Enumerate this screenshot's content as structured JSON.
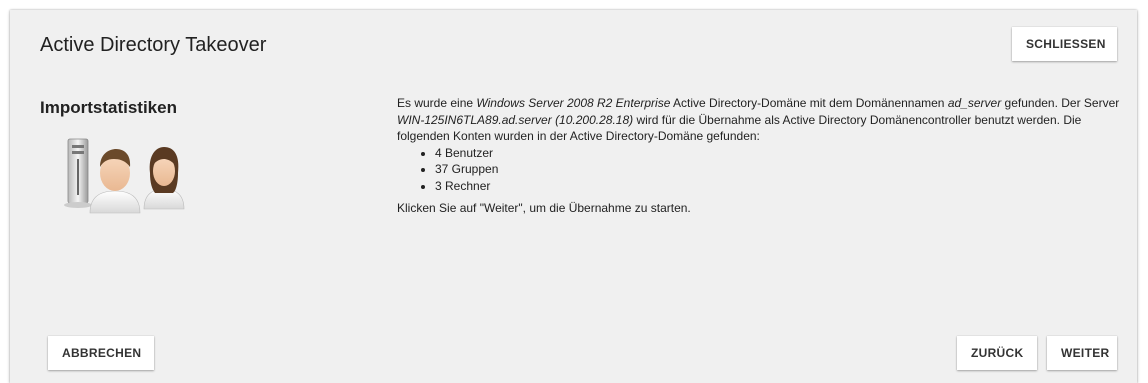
{
  "dialog": {
    "title": "Active Directory Takeover",
    "close_label": "SCHLIESSEN",
    "cancel_label": "ABBRECHEN",
    "back_label": "ZURÜCK",
    "next_label": "WEITER"
  },
  "sidebar": {
    "title": "Importstatistiken",
    "illustration_icon": "server-users-icon"
  },
  "content": {
    "intro_1": "Es wurde eine ",
    "os_name": "Windows Server 2008 R2 Enterprise",
    "intro_2": " Active Directory-Domäne mit dem Domänennamen ",
    "domain_name": "ad_server",
    "intro_3": " gefunden. Der Server ",
    "server_name": "WIN-125IN6TLA89.ad.server (10.200.28.18)",
    "intro_4": " wird für die Übernahme als Active Directory Domänencontroller benutzt werden. Die folgenden Konten wurden in der Active Directory-Domäne gefunden:",
    "accounts": [
      "4 Benutzer",
      "37 Gruppen",
      "3 Rechner"
    ],
    "footer": "Klicken Sie auf \"Weiter\", um die Übernahme zu starten."
  },
  "colors": {
    "dialog_bg": "#f0f0f0",
    "button_bg": "#ffffff"
  }
}
